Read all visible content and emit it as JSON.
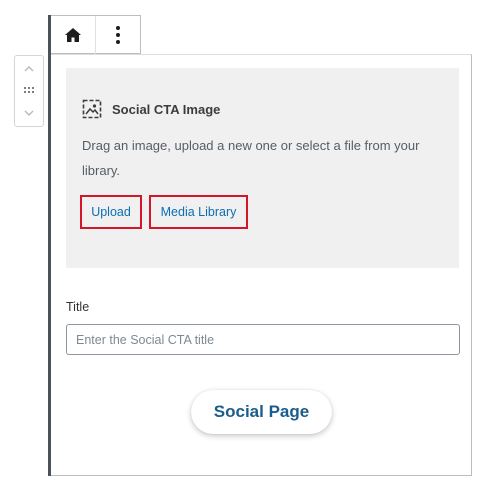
{
  "toolbar": {
    "home_icon": "home-icon",
    "more_icon": "more-vertical-icon"
  },
  "mover": {
    "up_icon": "chevron-up-icon",
    "drag_icon": "drag-handle-icon",
    "down_icon": "chevron-down-icon"
  },
  "placeholder": {
    "icon": "image-placeholder-icon",
    "title": "Social CTA Image",
    "instructions": "Drag an image, upload a new one or select a file from your library.",
    "upload_label": "Upload",
    "media_library_label": "Media Library"
  },
  "title_field": {
    "label": "Title",
    "value": "",
    "placeholder": "Enter the Social CTA title"
  },
  "social_button": {
    "label": "Social Page"
  },
  "colors": {
    "highlight_border": "#d3162a",
    "link": "#0a6fb5",
    "button_text": "#1b5e8e",
    "placeholder_bg": "#f0f0f0",
    "rail": "#4b5259"
  }
}
